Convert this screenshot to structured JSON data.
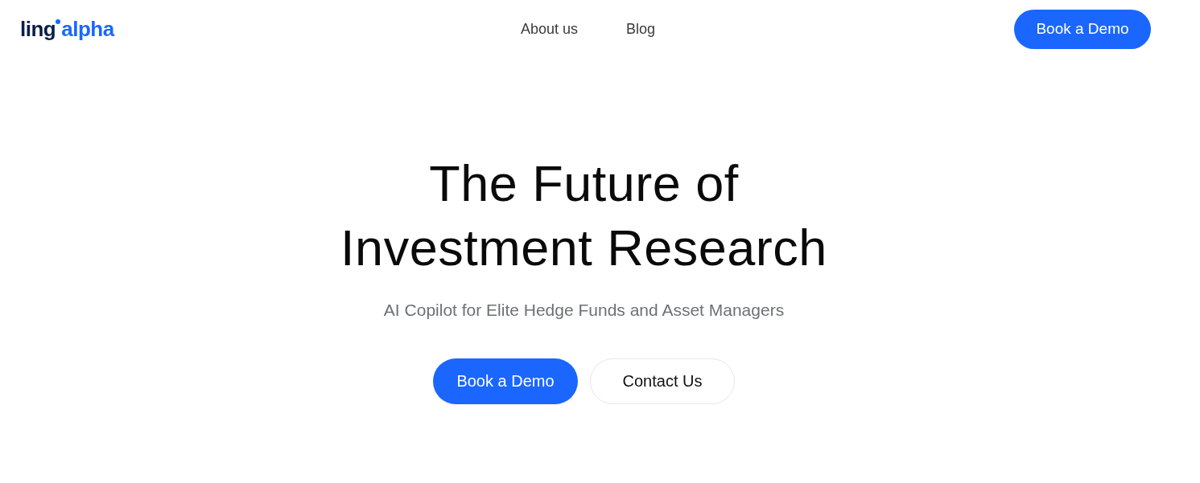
{
  "header": {
    "logo": {
      "word_start": "ling",
      "word_end": "alpha"
    },
    "nav_links": [
      "About us",
      "Blog"
    ],
    "cta_button": "Book a Demo"
  },
  "hero": {
    "title": "The Future of Investment Research",
    "subtitle": "AI Copilot for Elite Hedge Funds and Asset Managers",
    "buttons": [
      {
        "label": "Book a Demo",
        "kind": "primary"
      },
      {
        "label": "Contact Us",
        "kind": "outline"
      }
    ]
  }
}
